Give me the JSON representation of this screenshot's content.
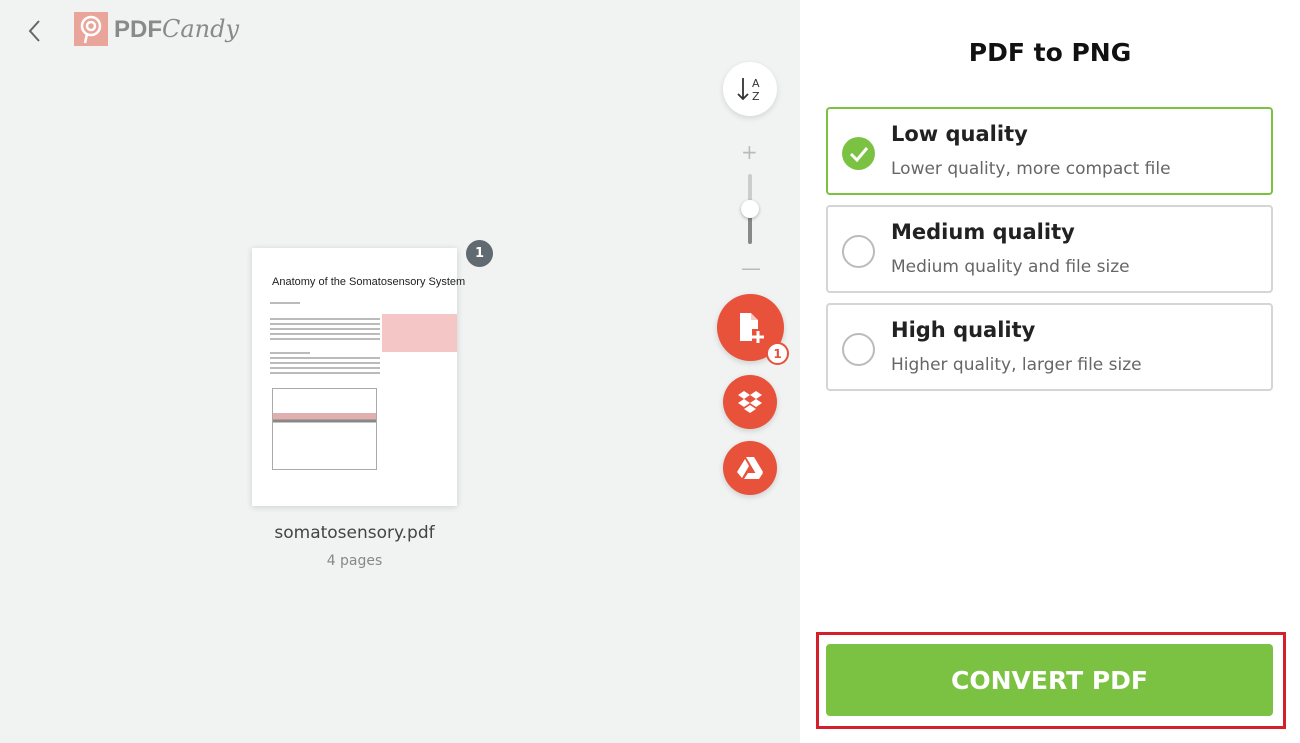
{
  "header": {
    "logo_text": "PDFCandy",
    "back_icon": "chevron-left-icon"
  },
  "toolbar": {
    "sort_icon": "sort-a-z-icon",
    "zoom_level": 0.5,
    "add_file_badge": "1",
    "add_file_icon": "file-plus-icon",
    "dropbox_icon": "dropbox-icon",
    "gdrive_icon": "google-drive-icon"
  },
  "file": {
    "name": "somatosensory.pdf",
    "pages": "4 pages",
    "page_badge": "1",
    "thumb_title": "Anatomy of the Somatosensory System"
  },
  "panel": {
    "title": "PDF to PNG",
    "options": [
      {
        "title": "Low quality",
        "desc": "Lower quality, more compact file",
        "selected": true
      },
      {
        "title": "Medium quality",
        "desc": "Medium quality and file size",
        "selected": false
      },
      {
        "title": "High quality",
        "desc": "Higher quality, larger file size",
        "selected": false
      }
    ],
    "convert_label": "CONVERT PDF"
  },
  "colors": {
    "accent_green": "#7cc242",
    "accent_red": "#e8513a",
    "highlight": "#d4202a"
  }
}
